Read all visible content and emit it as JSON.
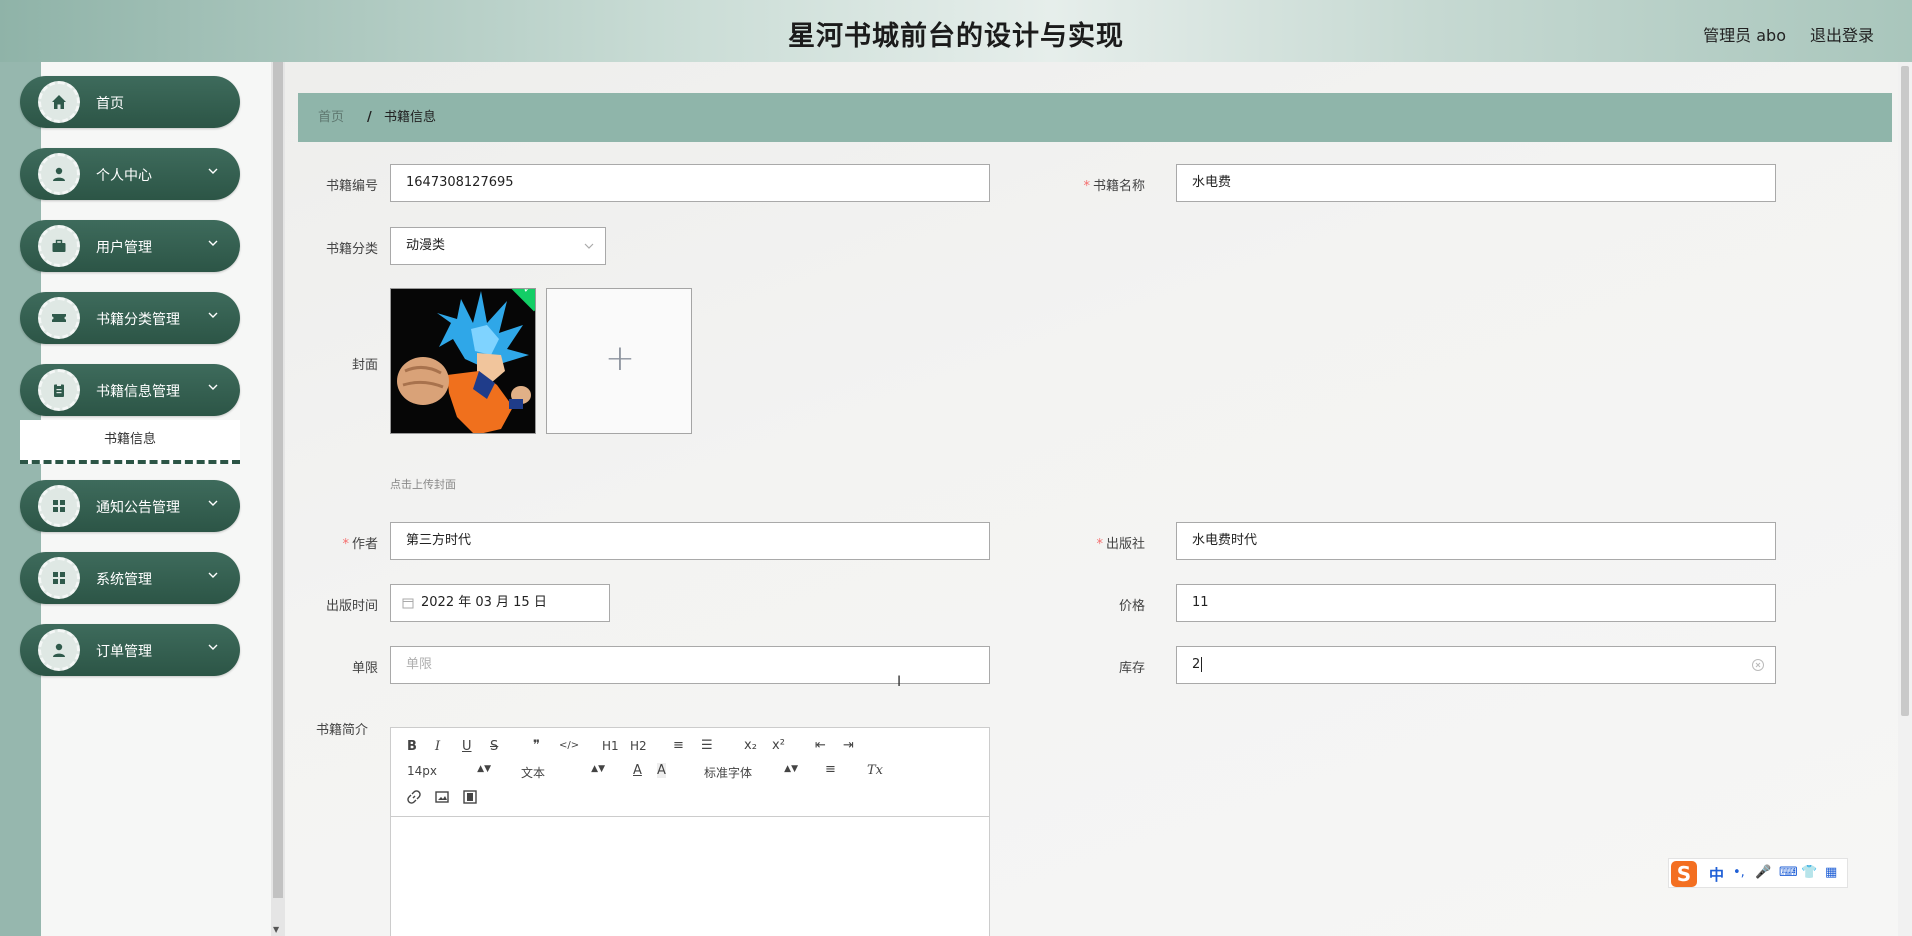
{
  "header": {
    "title": "星河书城前台的设计与实现",
    "user": "管理员 abo",
    "logout": "退出登录"
  },
  "sidebar": {
    "items": [
      {
        "label": "首页",
        "icon": "home-icon",
        "has_children": false
      },
      {
        "label": "个人中心",
        "icon": "user-icon",
        "has_children": true
      },
      {
        "label": "用户管理",
        "icon": "briefcase-icon",
        "has_children": true
      },
      {
        "label": "书籍分类管理",
        "icon": "ticket-icon",
        "has_children": true
      },
      {
        "label": "书籍信息管理",
        "icon": "clipboard-icon",
        "has_children": true
      },
      {
        "label": "通知公告管理",
        "icon": "grid-icon",
        "has_children": true
      },
      {
        "label": "系统管理",
        "icon": "grid-icon",
        "has_children": true
      },
      {
        "label": "订单管理",
        "icon": "user-icon",
        "has_children": true
      }
    ],
    "submenu_active": "书籍信息"
  },
  "breadcrumb": {
    "home": "首页",
    "separator": "/",
    "current": "书籍信息"
  },
  "form": {
    "book_no": {
      "label": "书籍编号",
      "value": "1647308127695",
      "required": false
    },
    "book_name": {
      "label": "书籍名称",
      "value": "水电费",
      "required": true
    },
    "category": {
      "label": "书籍分类",
      "value": "动漫类"
    },
    "cover": {
      "label": "封面",
      "hint": "点击上传封面",
      "plus": "+"
    },
    "author": {
      "label": "作者",
      "value": "第三方时代",
      "required": true
    },
    "publisher": {
      "label": "出版社",
      "value": "水电费时代",
      "required": true
    },
    "publish_date": {
      "label": "出版时间",
      "value": "2022 年 03 月 15 日"
    },
    "price": {
      "label": "价格",
      "value": "11"
    },
    "limit": {
      "label": "单限",
      "placeholder": "单限",
      "value": ""
    },
    "stock": {
      "label": "库存",
      "value": "2"
    },
    "intro": {
      "label": "书籍简介"
    },
    "required_mark": "*"
  },
  "editor": {
    "font_size": "14px",
    "heading": "文本",
    "font_family": "标准字体",
    "buttons": {
      "bold": "B",
      "italic": "I",
      "underline": "U",
      "strike": "S",
      "quote": "❞",
      "code": "</>",
      "h1": "H1",
      "h2": "H2",
      "ol": "≡",
      "ul": "☰",
      "sub": "x₂",
      "sup": "x²",
      "outdent": "⇤",
      "indent": "⇥",
      "color": "A",
      "bg": "A",
      "align": "≡",
      "clean": "Tx"
    }
  },
  "ime": {
    "logo": "S",
    "mode": "中",
    "punct": "•,",
    "mic": "🎤",
    "keyboard": "⌨",
    "skin": "👕",
    "apps": "▦"
  },
  "colors": {
    "sidebar_item": "#2c5546",
    "breadcrumb_bg": "#8fb5aa",
    "required": "#f56c6c",
    "upload_success": "#13ce66",
    "ime_accent": "#f36f21"
  }
}
